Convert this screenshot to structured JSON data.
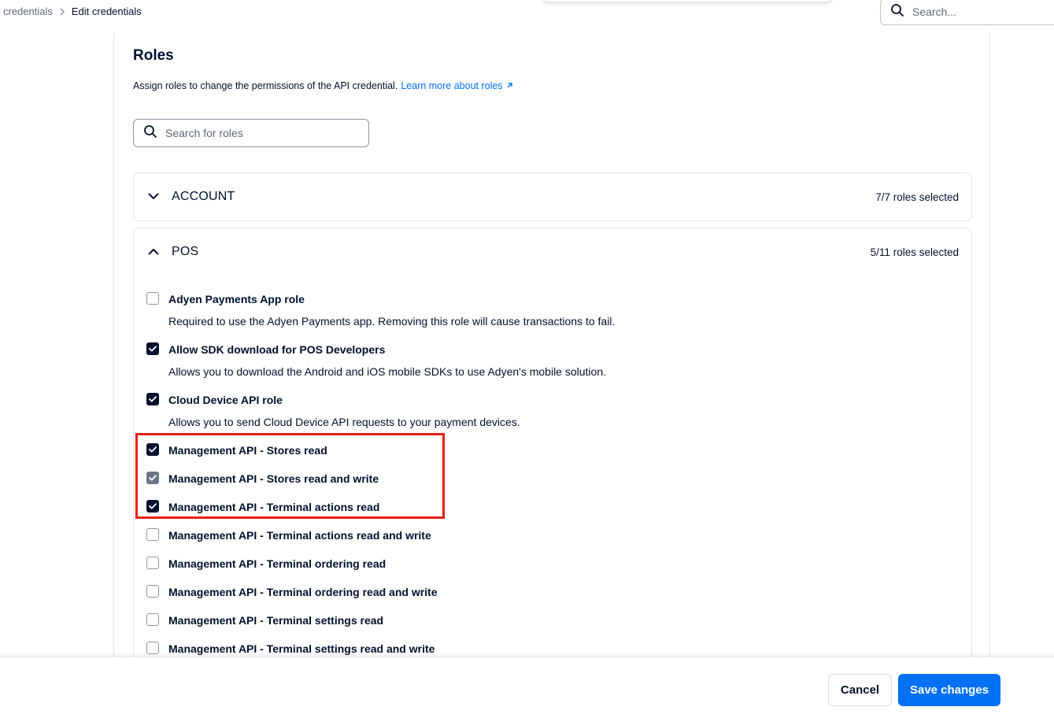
{
  "breadcrumb": {
    "previous": "credentials",
    "current": "Edit credentials"
  },
  "header": {
    "search_placeholder": "Search..."
  },
  "roles": {
    "title": "Roles",
    "description": "Assign roles to change the permissions of the API credential.",
    "learn_more": "Learn more about roles",
    "search_placeholder": "Search for roles"
  },
  "groups": {
    "account": {
      "name": "ACCOUNT",
      "count": "7/7 roles selected",
      "expanded": false
    },
    "pos": {
      "name": "POS",
      "count": "5/11 roles selected",
      "expanded": true,
      "items": [
        {
          "label": "Adyen Payments App role",
          "desc": "Required to use the Adyen Payments app. Removing this role will cause transactions to fail.",
          "state": "unchecked"
        },
        {
          "label": "Allow SDK download for POS Developers",
          "desc": "Allows you to download the Android and iOS mobile SDKs to use Adyen's mobile solution.",
          "state": "checked"
        },
        {
          "label": "Cloud Device API role",
          "desc": "Allows you to send Cloud Device API requests to your payment devices.",
          "state": "checked"
        },
        {
          "label": "Management API - Stores read",
          "state": "checked"
        },
        {
          "label": "Management API - Stores read and write",
          "state": "checked-disabled"
        },
        {
          "label": "Management API - Terminal actions read",
          "state": "checked"
        },
        {
          "label": "Management API - Terminal actions read and write",
          "state": "unchecked"
        },
        {
          "label": "Management API - Terminal ordering read",
          "state": "unchecked"
        },
        {
          "label": "Management API - Terminal ordering read and write",
          "state": "unchecked"
        },
        {
          "label": "Management API - Terminal settings read",
          "state": "unchecked"
        },
        {
          "label": "Management API - Terminal settings read and write",
          "state": "unchecked"
        }
      ]
    }
  },
  "footer": {
    "cancel_label": "Cancel",
    "save_label": "Save changes"
  },
  "colors": {
    "primary": "#0070f5",
    "text": "#00112c",
    "checkbox_checked": "#00112c",
    "checkbox_disabled": "#6c7686",
    "annotation": "#e8210f"
  }
}
